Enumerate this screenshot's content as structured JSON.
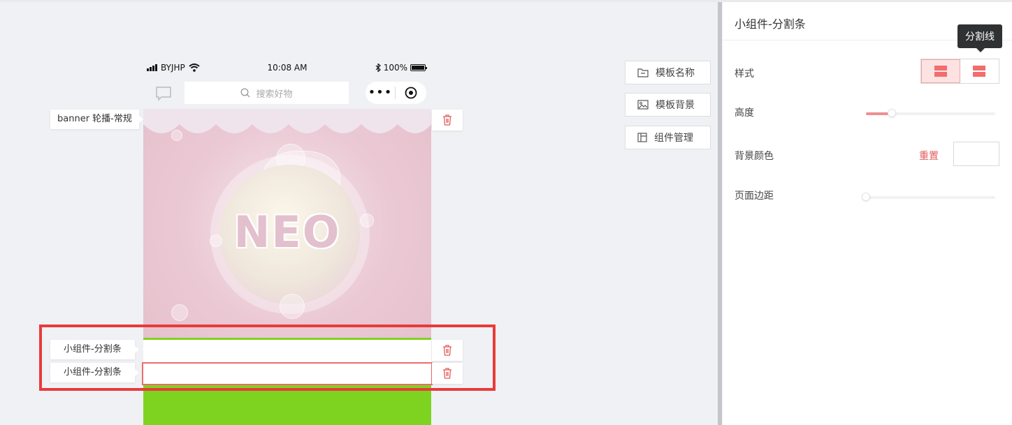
{
  "status_bar": {
    "carrier": "BYJHP",
    "time": "10:08 AM",
    "battery": "100%"
  },
  "nav_bar": {
    "search_placeholder": "搜索好物"
  },
  "components": [
    {
      "label": "banner 轮播-常规",
      "delete_icon": "trash-icon"
    },
    {
      "label": "小组件-分割条",
      "delete_icon": "trash-icon"
    },
    {
      "label": "小组件-分割条",
      "delete_icon": "trash-icon",
      "active": true
    }
  ],
  "banner": {
    "text": "NEO"
  },
  "toolbar": {
    "template_name": "模板名称",
    "template_bg": "模板背景",
    "component_mgmt": "组件管理"
  },
  "panel": {
    "title": "小组件-分割条",
    "tooltip": "分割线",
    "style_label": "样式",
    "height_label": "高度",
    "height_level": 0.2,
    "bg_color_label": "背景颜色",
    "reset_label": "重置",
    "padding_label": "页面边距",
    "padding_level": 0
  },
  "colors": {
    "accent": "#e45c5c",
    "highlight_border": "#e83b3b",
    "green": "#7ed321",
    "panel_bg": "#ffffff"
  }
}
